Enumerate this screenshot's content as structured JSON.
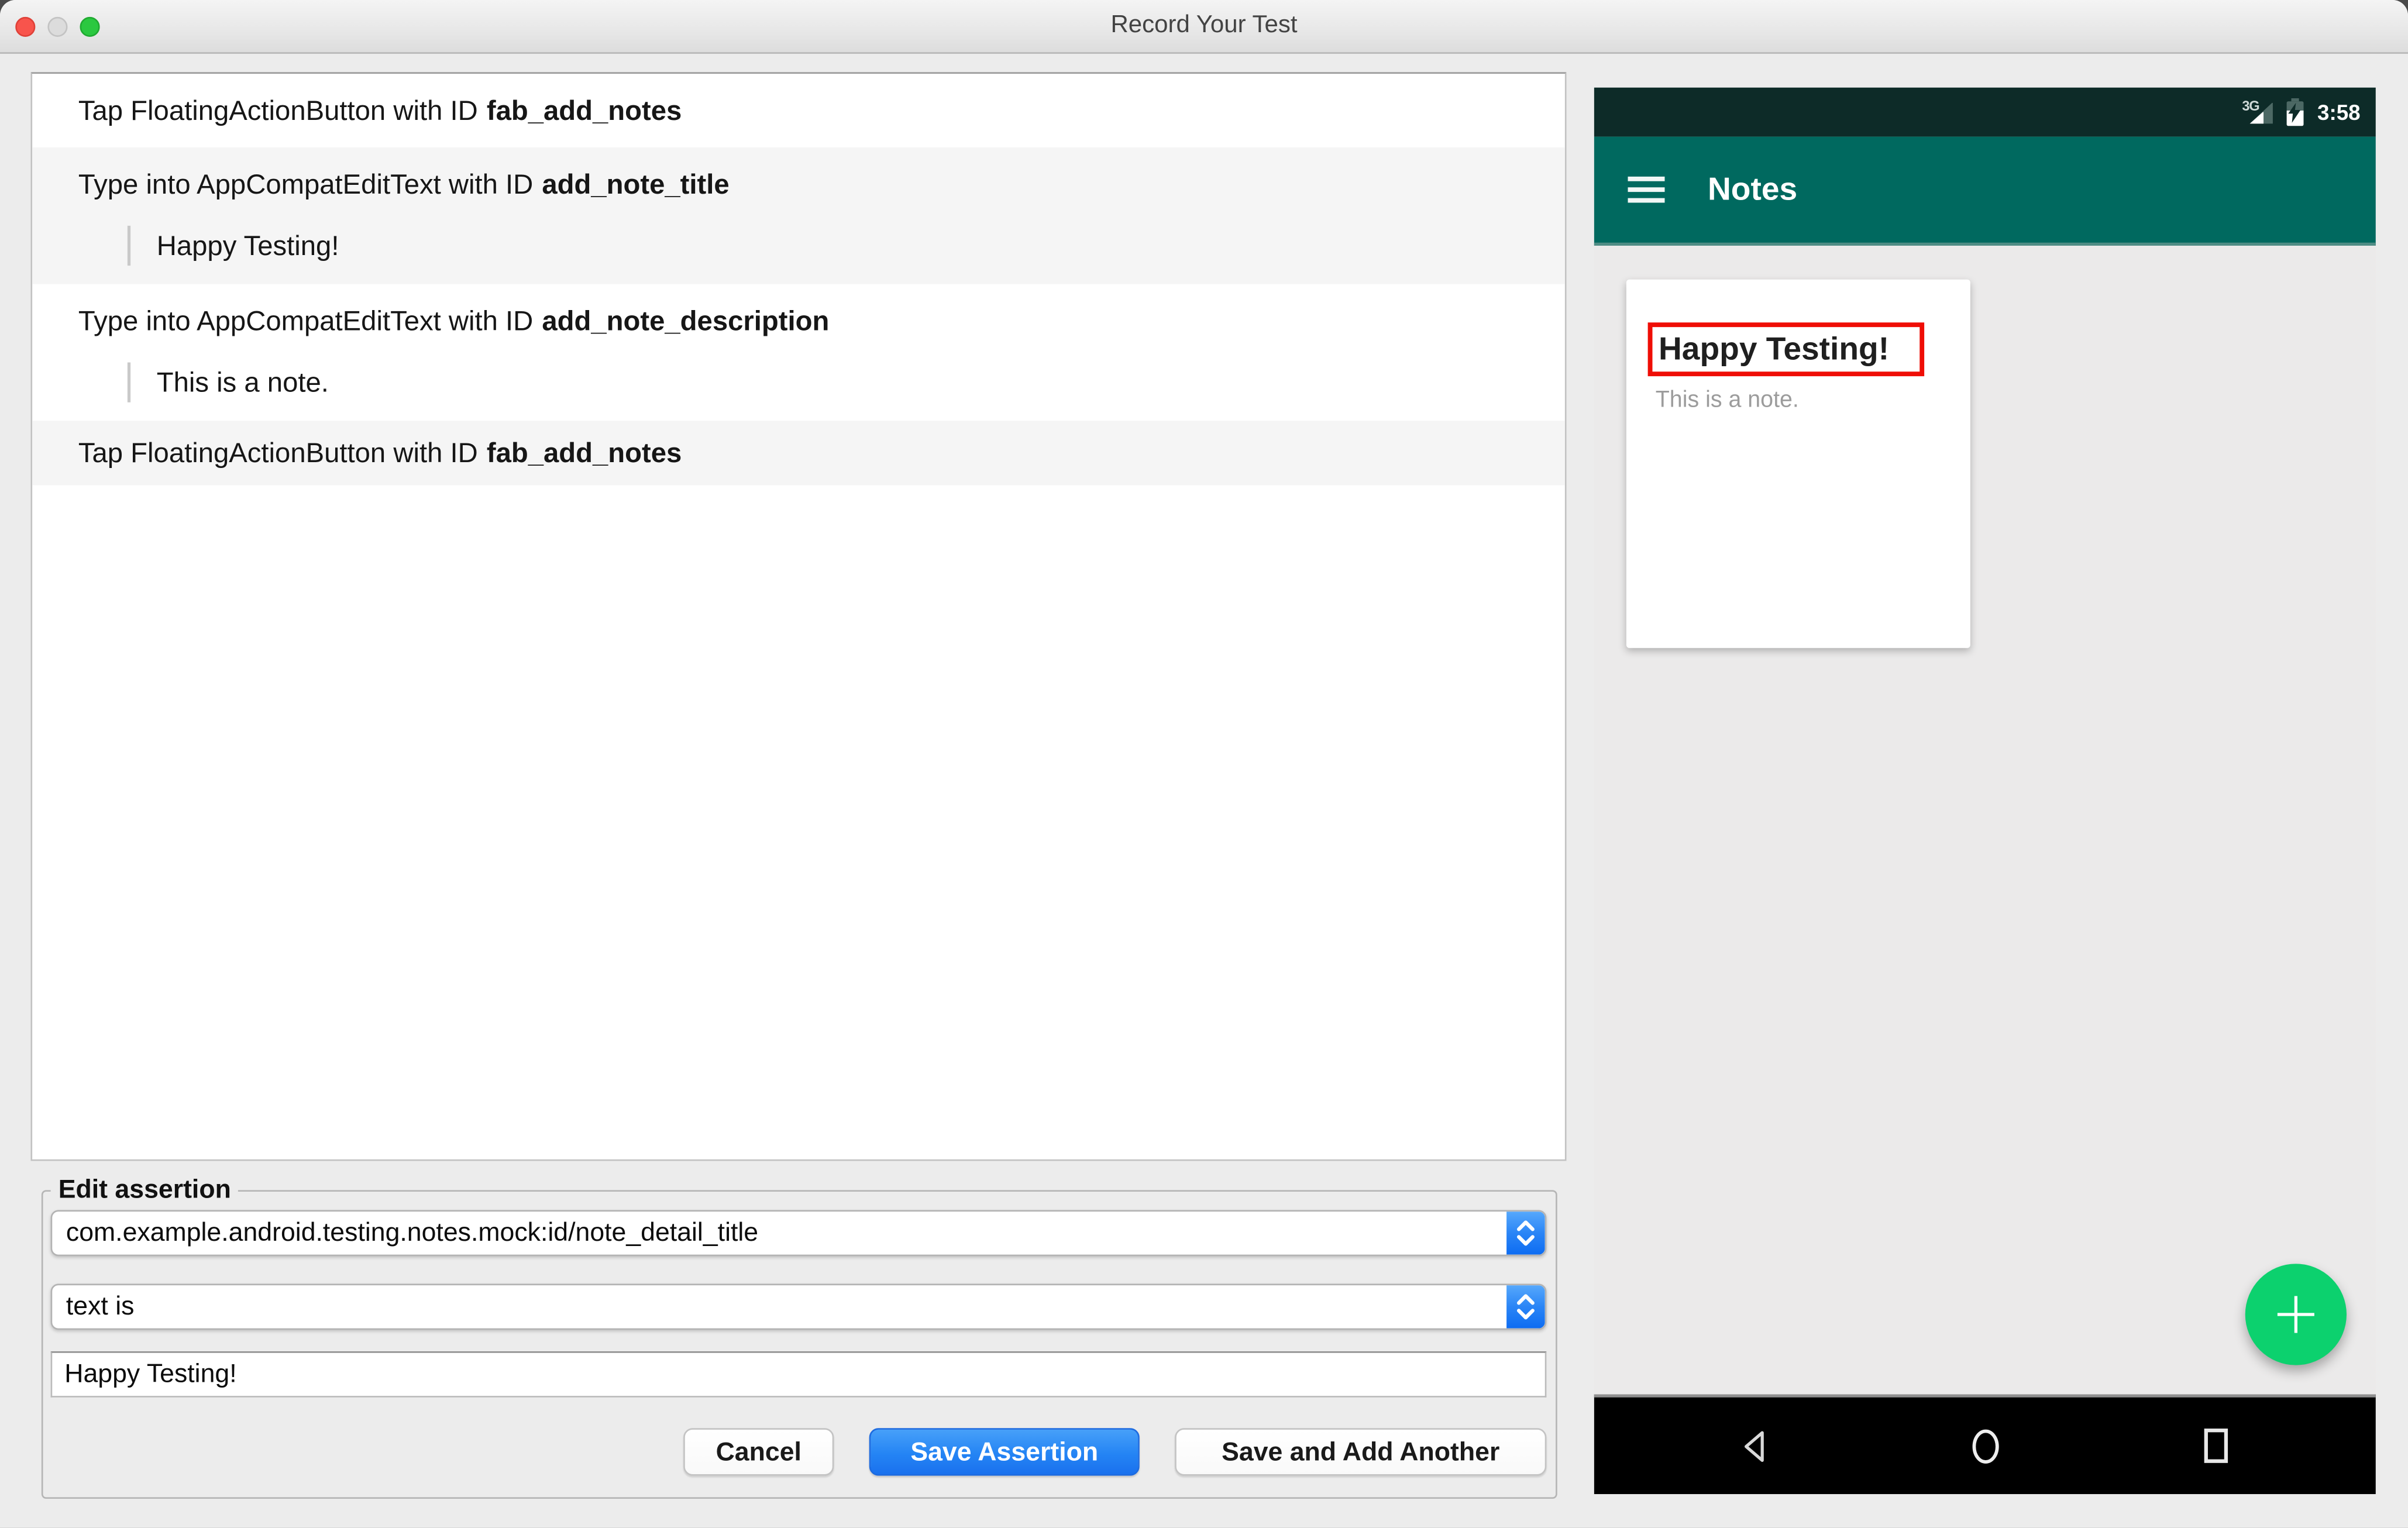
{
  "window": {
    "title": "Record Your Test"
  },
  "action_list": {
    "items": [
      {
        "action": "Tap FloatingActionButton with ID",
        "target_id": "fab_add_notes",
        "typed_text": ""
      },
      {
        "action": "Type into AppCompatEditText with ID",
        "target_id": "add_note_title",
        "typed_text": "Happy Testing!"
      },
      {
        "action": "Type into AppCompatEditText with ID",
        "target_id": "add_note_description",
        "typed_text": "This is a note."
      },
      {
        "action": "Tap FloatingActionButton with ID",
        "target_id": "fab_add_notes",
        "typed_text": ""
      }
    ]
  },
  "edit_assertion": {
    "legend": "Edit assertion",
    "matcher_select": {
      "value": "com.example.android.testing.notes.mock:id/note_detail_title"
    },
    "type_select": {
      "value": "text is"
    },
    "value_input": {
      "value": "Happy Testing!"
    },
    "buttons": {
      "cancel": "Cancel",
      "save": "Save Assertion",
      "save_add": "Save and Add Another"
    }
  },
  "device": {
    "status_bar": {
      "network_label": "3G",
      "time": "3:58",
      "battery_state": "charging"
    },
    "app_bar": {
      "title": "Notes"
    },
    "note_card": {
      "title": "Happy Testing!",
      "description": "This is a note."
    },
    "fab": {
      "icon": "plus-icon"
    },
    "nav_bar": {
      "icons": [
        "back",
        "home",
        "recents"
      ]
    }
  },
  "colors": {
    "accent_blue": "#2a85f6",
    "app_bar_teal": "#00695f",
    "status_bar_teal": "#0d2b28",
    "fab_green": "#0cd16e",
    "highlight_red": "#ef0d06",
    "selection_alt_row": "#f5f5f5"
  }
}
